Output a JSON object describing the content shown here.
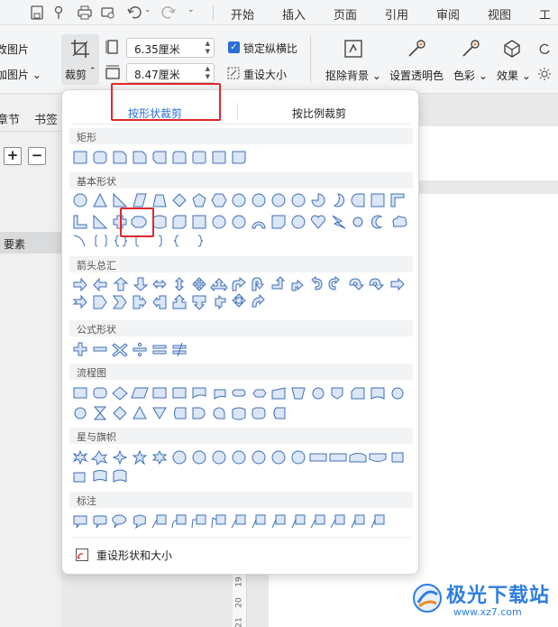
{
  "menu": [
    "开始",
    "插入",
    "页面",
    "引用",
    "审阅",
    "视图",
    "工具"
  ],
  "ribbon": {
    "left_partial_1": "改图片",
    "left_partial_2": "加图片",
    "crop_label": "裁剪",
    "width_value": "6.35厘米",
    "height_value": "8.47厘米",
    "lock_ratio": "锁定纵横比",
    "reset_size": "重设大小",
    "remove_bg": "抠除背景",
    "set_transparent": "设置透明色",
    "color": "色彩",
    "effect": "效果"
  },
  "leftpane": {
    "tab_sections": "章节",
    "tab_bookmarks": "书签",
    "plus": "+",
    "minus": "−",
    "selected_item": "要素"
  },
  "panel": {
    "tab_by_shape": "按形状裁剪",
    "tab_by_ratio": "按比例裁剪",
    "sections": [
      "矩形",
      "基本形状",
      "箭头总汇",
      "公式形状",
      "流程图",
      "星与旗帜",
      "标注"
    ],
    "reset_label": "重设形状和大小"
  },
  "ruler_numbers": [
    "19",
    "20",
    "21"
  ],
  "watermark": {
    "title": "极光下载站",
    "url": "www.xz7.com"
  },
  "colors": {
    "accent": "#2a6fd6",
    "shape_fill": "#dbe6f7",
    "shape_stroke": "#3f6fb4",
    "highlight": "#e0282c"
  }
}
